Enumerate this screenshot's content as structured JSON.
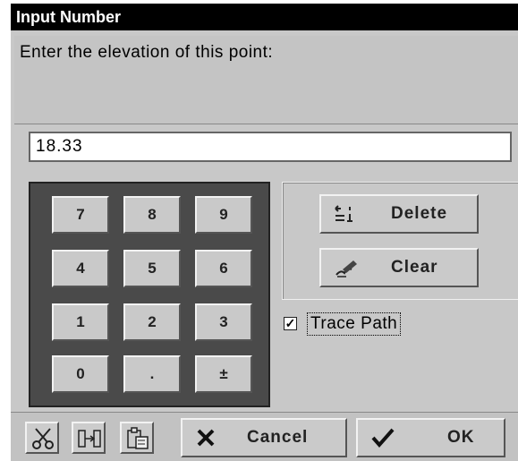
{
  "window": {
    "title": "Input Number"
  },
  "prompt": {
    "text": "Enter the elevation of this point:"
  },
  "input": {
    "value": "18.33"
  },
  "keypad": {
    "keys": [
      "7",
      "8",
      "9",
      "4",
      "5",
      "6",
      "1",
      "2",
      "3",
      "0",
      ".",
      "±"
    ]
  },
  "actions": {
    "delete_label": "Delete",
    "clear_label": "Clear"
  },
  "trace_path": {
    "label": "Trace Path",
    "checked": true,
    "check_mark": "✓"
  },
  "bottom": {
    "cancel_label": "Cancel",
    "ok_label": "OK"
  },
  "colors": {
    "titlebar_bg": "#000000",
    "dialog_bg": "#c8c8c8",
    "keypad_bg": "#4a4a4a"
  }
}
